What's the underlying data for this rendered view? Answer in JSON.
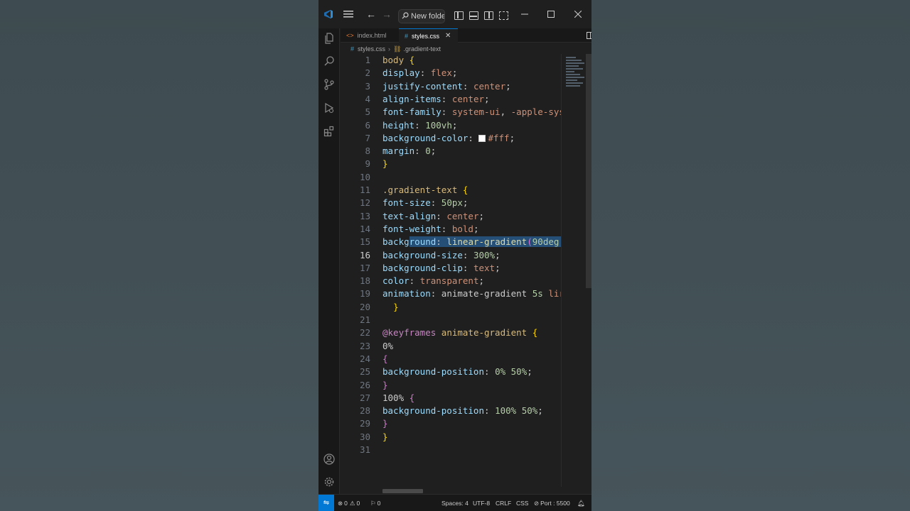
{
  "titlebar": {
    "search_text": "New folde"
  },
  "tabs": [
    {
      "label": "index.html",
      "icon": "html-file-icon",
      "active": false
    },
    {
      "label": "styles.css",
      "icon": "css-file-icon",
      "active": true
    }
  ],
  "breadcrumb": {
    "file": "styles.css",
    "symbol": ".gradient-text"
  },
  "editor": {
    "current_line": 16,
    "line_numbers": [
      "1",
      "2",
      "3",
      "4",
      "5",
      "6",
      "7",
      "8",
      "9",
      "10",
      "11",
      "12",
      "13",
      "14",
      "15",
      "16",
      "17",
      "18",
      "19",
      "20",
      "21",
      "22",
      "23",
      "24",
      "25",
      "26",
      "27",
      "28",
      "29",
      "30",
      "31"
    ]
  },
  "statusbar": {
    "problems_errors": "0",
    "problems_warnings": "0",
    "ports_forwarded": "0",
    "spaces": "Spaces: 4",
    "encoding": "UTF-8",
    "eol": "CRLF",
    "language": "CSS",
    "port": "Port : 5500"
  },
  "colors": {
    "accent": "#0078d4",
    "editor_bg": "#1f1f1f",
    "background": "#3f4c52"
  }
}
